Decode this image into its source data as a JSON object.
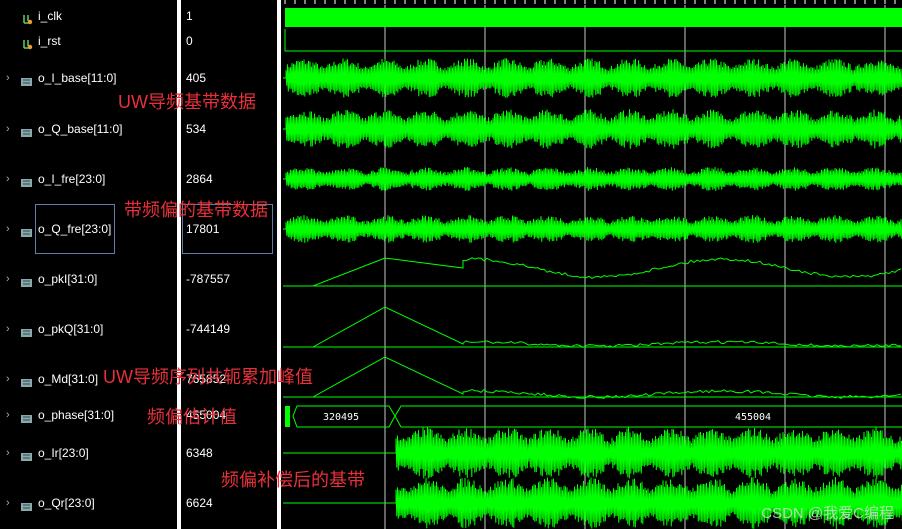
{
  "signals": [
    {
      "name": "i_clk",
      "value": "1",
      "kind": "bit"
    },
    {
      "name": "i_rst",
      "value": "0",
      "kind": "bit"
    },
    {
      "name": "o_I_base[11:0]",
      "value": "405",
      "kind": "bus"
    },
    {
      "name": "o_Q_base[11:0]",
      "value": "534",
      "kind": "bus"
    },
    {
      "name": "o_I_fre[23:0]",
      "value": "2864",
      "kind": "bus"
    },
    {
      "name": "o_Q_fre[23:0]",
      "value": "17801",
      "kind": "bus"
    },
    {
      "name": "o_pkI[31:0]",
      "value": "-787557",
      "kind": "bus"
    },
    {
      "name": "o_pkQ[31:0]",
      "value": "-744149",
      "kind": "bus"
    },
    {
      "name": "o_Md[31:0]",
      "value": "765852",
      "kind": "bus"
    },
    {
      "name": "o_phase[31:0]",
      "value": "455004",
      "kind": "bus"
    },
    {
      "name": "o_Ir[23:0]",
      "value": "6348",
      "kind": "bus"
    },
    {
      "name": "o_Qr[23:0]",
      "value": "6624",
      "kind": "bus"
    }
  ],
  "phase_segments": [
    "320495",
    "455004"
  ],
  "annotations": {
    "uw_base": "UW导频基带数据",
    "with_offset": "带频偏的基带数据",
    "peak": "UW导频序列共轭累加峰值",
    "estimate": "频偏估计值",
    "compensated": "频偏补偿后的基带"
  },
  "watermark": "CSDN @我爱C编程",
  "colors": {
    "wave": "#00ff00",
    "grid": "#c8c8c8",
    "annotation": "#e8303a"
  }
}
